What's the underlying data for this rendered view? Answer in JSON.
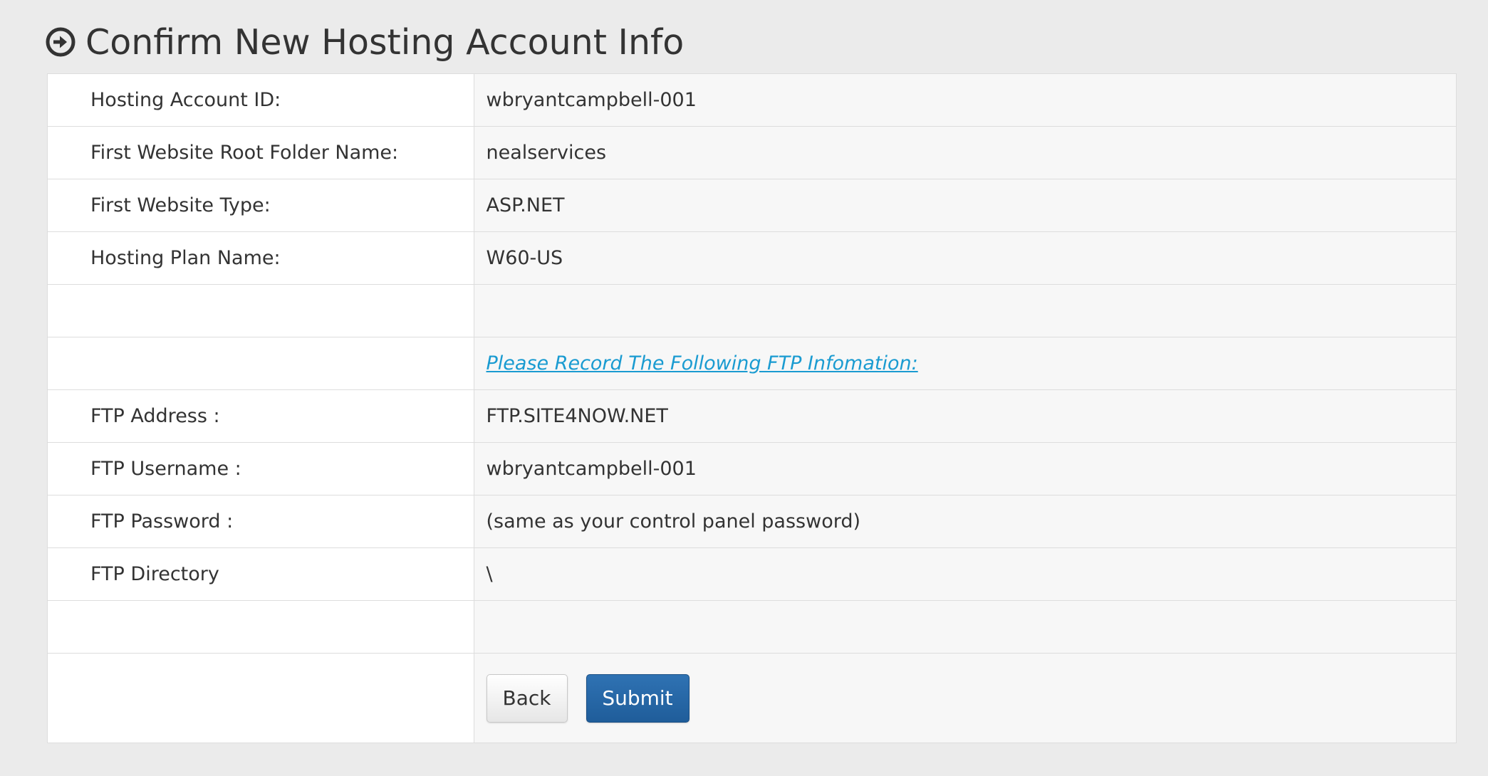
{
  "header": {
    "icon": "arrow-circle-right-icon",
    "title": "Confirm New Hosting Account Info"
  },
  "rows": [
    {
      "label": "Hosting Account ID:",
      "value": "wbryantcampbell-001"
    },
    {
      "label": "First Website Root Folder Name:",
      "value": "nealservices"
    },
    {
      "label": "First Website Type:",
      "value": "ASP.NET"
    },
    {
      "label": "Hosting Plan Name:",
      "value": "W60-US"
    },
    {
      "label": "",
      "value": ""
    },
    {
      "label": "",
      "value": "Please Record The Following FTP Infomation:"
    },
    {
      "label": "FTP Address :",
      "value": "FTP.SITE4NOW.NET"
    },
    {
      "label": "FTP Username :",
      "value": "wbryantcampbell-001"
    },
    {
      "label": "FTP Password :",
      "value": "(same as your control panel password)"
    },
    {
      "label": "FTP Directory",
      "value": "\\"
    },
    {
      "label": "",
      "value": ""
    }
  ],
  "actions": {
    "back_label": "Back",
    "submit_label": "Submit"
  },
  "colors": {
    "background": "#ebebeb",
    "link": "#1a9bd1",
    "primary_button": "#2a6aa9",
    "value_cell": "#f7f7f7",
    "border": "#dddddd"
  }
}
